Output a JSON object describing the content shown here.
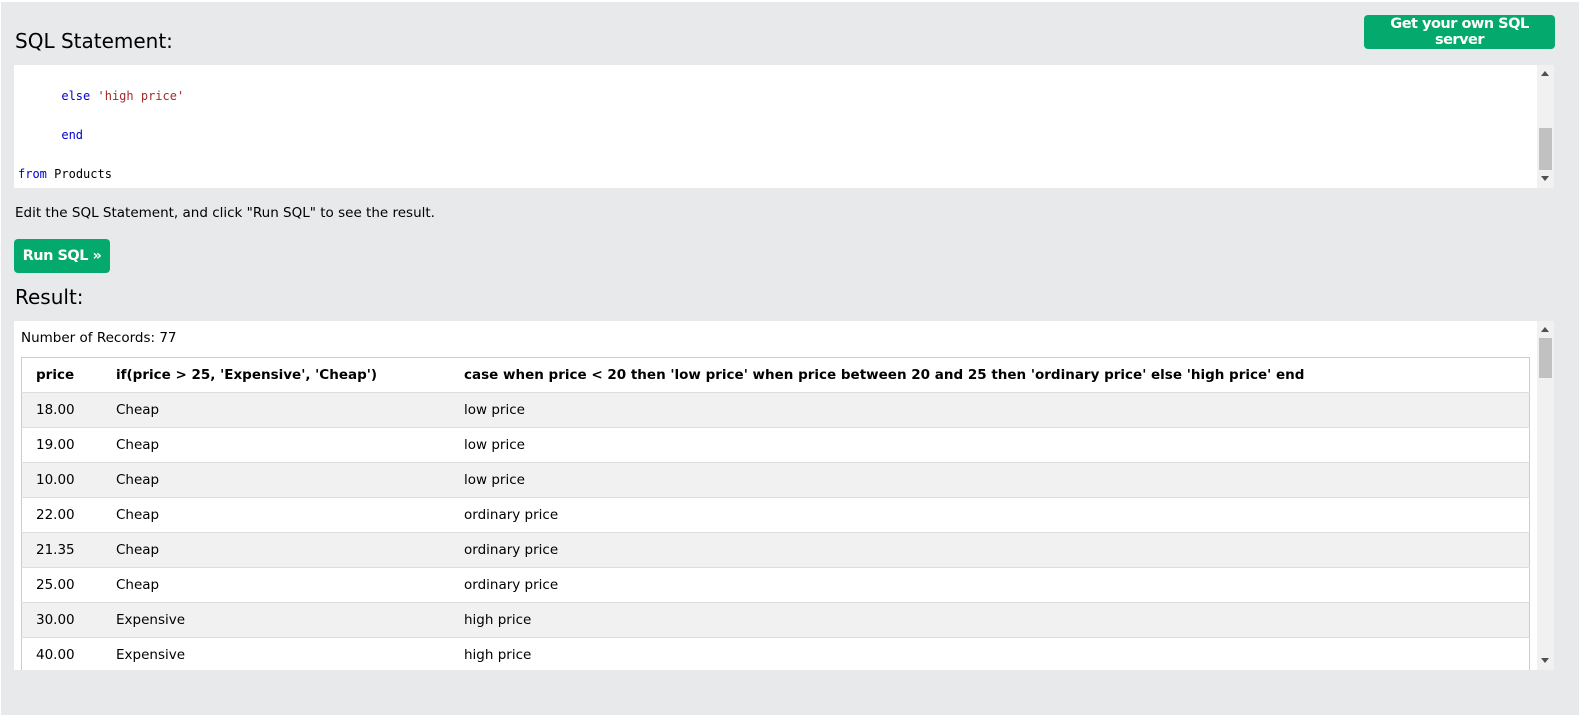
{
  "header": {
    "sql_heading": "SQL Statement:",
    "server_button": "Get your own SQL server"
  },
  "editor": {
    "lines": [
      {
        "indent": "      ",
        "kw": "else",
        "str": "'high price'"
      },
      {
        "indent": "      ",
        "kw": "end"
      },
      {
        "kw": "from",
        "plain": "Products"
      }
    ]
  },
  "hint": "Edit the SQL Statement, and click \"Run SQL\" to see the result.",
  "run_button": "Run SQL »",
  "result": {
    "heading": "Result:",
    "records": "Number of Records: 77",
    "columns": [
      "price",
      "if(price > 25, 'Expensive', 'Cheap')",
      "case when price < 20 then 'low price' when price between 20 and 25 then 'ordinary price' else 'high price' end"
    ],
    "rows": [
      [
        "18.00",
        "Cheap",
        "low price"
      ],
      [
        "19.00",
        "Cheap",
        "low price"
      ],
      [
        "10.00",
        "Cheap",
        "low price"
      ],
      [
        "22.00",
        "Cheap",
        "ordinary price"
      ],
      [
        "21.35",
        "Cheap",
        "ordinary price"
      ],
      [
        "25.00",
        "Cheap",
        "ordinary price"
      ],
      [
        "30.00",
        "Expensive",
        "high price"
      ],
      [
        "40.00",
        "Expensive",
        "high price"
      ]
    ]
  },
  "colors": {
    "accent": "#04aa6d",
    "background": "#e7e9eb",
    "keyword": "#0000cd",
    "string": "#a52a2a"
  }
}
